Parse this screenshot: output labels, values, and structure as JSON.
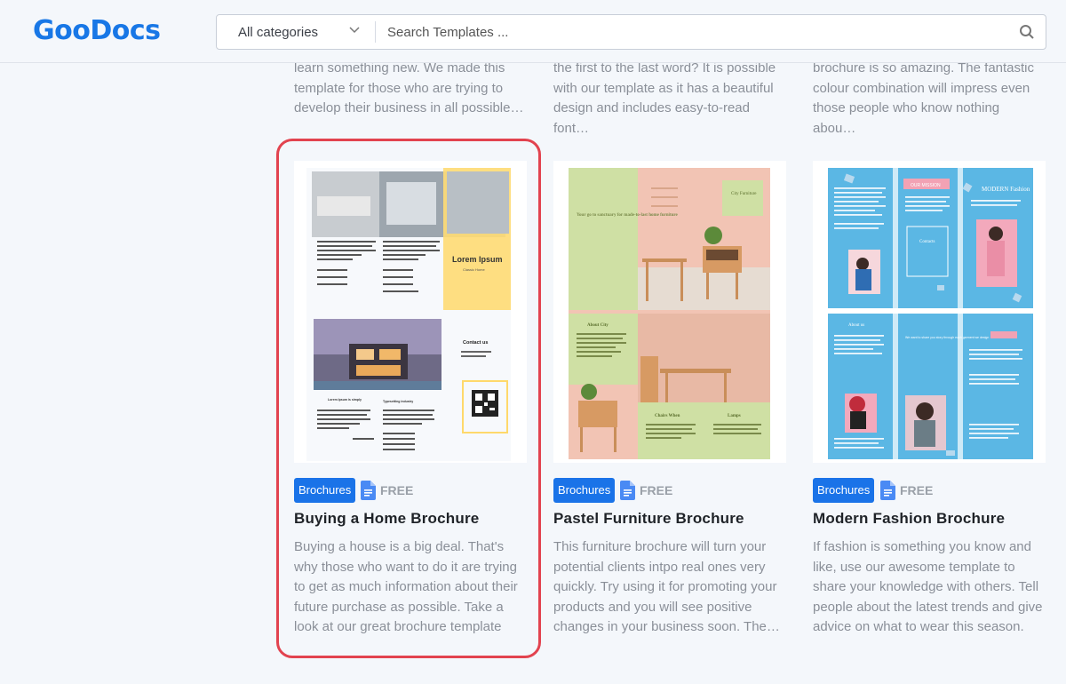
{
  "header": {
    "logo_text": "GooDocs",
    "category_select": {
      "value": "All categories"
    },
    "search": {
      "placeholder": "Search Templates ..."
    }
  },
  "top_row_descriptions": [
    "learn something new. We made this template for those who are trying to develop their business in all possible…",
    "the first to the last word? It is possible with our template as it has a beautiful design and includes easy-to-read font…",
    "brochure is so amazing. The fantastic colour combination will impress even those people who know nothing abou…"
  ],
  "cards": [
    {
      "category": "Brochures",
      "price": "FREE",
      "title": "Buying a Home Brochure",
      "description": "Buying a house is a big deal. That's why those who want to do it are trying to get as much information about their future purchase as possible. Take a look at our great brochure template with which y…",
      "thumb": {
        "heading": "Lorem Ipsum",
        "sub": "Classic Home",
        "contact": "Contact us",
        "caption1": "Lorem Ipsum is simply",
        "caption2": "Typesetting industry"
      }
    },
    {
      "category": "Brochures",
      "price": "FREE",
      "title": "Pastel Furniture Brochure",
      "description": "This furniture brochure will turn your potential clients intpo real ones very quickly. Try using it for promoting your products and you will see positive changes in your business soon. The…",
      "thumb": {
        "heading": "City Furniture",
        "tagline": "Your go to sanctuary for made-to-last home furniture",
        "about": "About City",
        "chairs": "Chairs When",
        "lamps": "Lamps"
      }
    },
    {
      "category": "Brochures",
      "price": "FREE",
      "title": "Modern Fashion Brochure",
      "description": "If fashion is something you know and like, use our awesome template to share your knowledge with others. Tell people about the latest trends and give advice on what to wear this season. T…",
      "thumb": {
        "mission": "OUR MISSION",
        "heading": "MODERN Fashion",
        "contacts": "Contacts",
        "about": "About us",
        "share": "We want to share you story through each garment we design"
      }
    }
  ],
  "colors": {
    "brand": "#1877e6",
    "badge": "#1a73e8",
    "highlight": "#e2434f",
    "pastel_green": "#cfe0a4",
    "pastel_pink": "#f2c4b4",
    "fashion_blue": "#5bb7e4"
  }
}
